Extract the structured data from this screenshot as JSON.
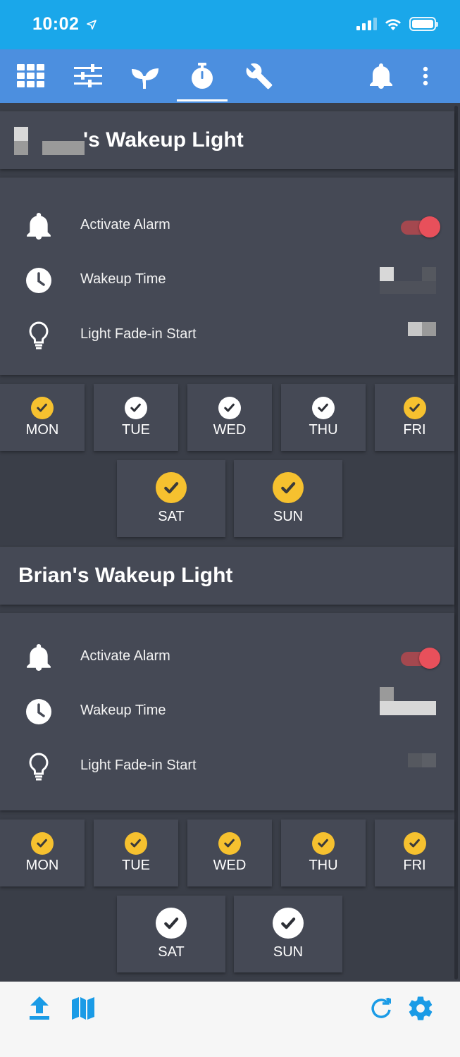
{
  "status_bar": {
    "time": "10:02",
    "location_arrow": "location-arrow-icon",
    "icons": [
      "cellular-signal-icon",
      "wifi-icon",
      "battery-icon"
    ]
  },
  "nav": {
    "items": [
      {
        "icon": "grid-icon",
        "active": false
      },
      {
        "icon": "sliders-icon",
        "active": false
      },
      {
        "icon": "sprout-icon",
        "active": false
      },
      {
        "icon": "stopwatch-icon",
        "active": true
      },
      {
        "icon": "wrench-icon",
        "active": false
      },
      {
        "icon": "bell-icon",
        "active": false
      },
      {
        "icon": "more-vertical-icon",
        "active": false
      }
    ]
  },
  "sections": [
    {
      "title_visible": "'s Wakeup Light",
      "alarm_label": "Activate Alarm",
      "alarm_on": true,
      "wakeup_label": "Wakeup Time",
      "fade_label": "Light Fade-in Start",
      "weekdays": [
        {
          "label": "MON",
          "check": "yellow"
        },
        {
          "label": "TUE",
          "check": "white"
        },
        {
          "label": "WED",
          "check": "white"
        },
        {
          "label": "THU",
          "check": "white"
        },
        {
          "label": "FRI",
          "check": "yellow"
        }
      ],
      "weekend": [
        {
          "label": "SAT",
          "check": "yellow"
        },
        {
          "label": "SUN",
          "check": "yellow"
        }
      ]
    },
    {
      "title": "Brian's Wakeup Light",
      "alarm_label": "Activate Alarm",
      "alarm_on": true,
      "wakeup_label": "Wakeup Time",
      "fade_label": "Light Fade-in Start",
      "weekdays": [
        {
          "label": "MON",
          "check": "yellow"
        },
        {
          "label": "TUE",
          "check": "yellow"
        },
        {
          "label": "WED",
          "check": "yellow"
        },
        {
          "label": "THU",
          "check": "yellow"
        },
        {
          "label": "FRI",
          "check": "yellow"
        }
      ],
      "weekend": [
        {
          "label": "SAT",
          "check": "white"
        },
        {
          "label": "SUN",
          "check": "white"
        }
      ]
    }
  ],
  "bottom_bar": {
    "left": [
      "upload-icon",
      "map-icon"
    ],
    "right": [
      "refresh-icon",
      "settings-icon"
    ]
  },
  "colors": {
    "status_bar": "#1aa7ea",
    "nav_bar": "#4c8fdf",
    "background": "#3a3e48",
    "card": "#454955",
    "check_yellow": "#f6c12f",
    "toggle_on": "#e8505b",
    "accent_blue": "#1a9be6"
  }
}
